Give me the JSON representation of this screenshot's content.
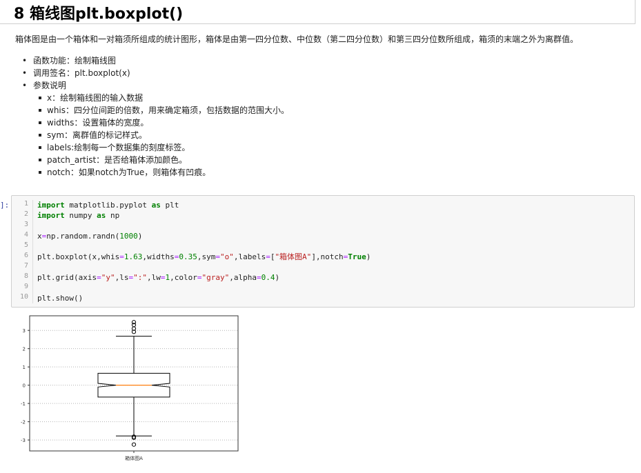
{
  "header": {
    "title": "8  箱线图plt.boxplot()"
  },
  "description": "箱体图是由一个箱体和一对箱须所组成的统计图形，箱体是由第一四分位数、中位数（第二四分位数）和第三四分位数所组成，箱须的末端之外为离群值。",
  "bullets": [
    "函数功能：绘制箱线图",
    "调用签名：plt.boxplot(x)",
    "参数说明"
  ],
  "params": [
    "x：绘制箱线图的输入数据",
    "whis：四分位间距的倍数，用来确定箱须，包括数据的范围大小。",
    "widths：设置箱体的宽度。",
    "sym：离群值的标记样式。",
    "labels:绘制每一个数据集的刻度标签。",
    "patch_artist：是否给箱体添加颜色。",
    "notch：如果notch为True，则箱体有凹痕。"
  ],
  "cell": {
    "prompt": "]:",
    "line_numbers": [
      "1",
      "2",
      "3",
      "4",
      "5",
      "6",
      "7",
      "8",
      "9",
      "10"
    ]
  },
  "code_lines": [
    "import matplotlib.pyplot as plt",
    "import numpy as np",
    "",
    "x=np.random.randn(1000)",
    "",
    "plt.boxplot(x,whis=1.63,widths=0.35,sym=\"o\",labels=[\"箱体图A\"],notch=True)",
    "",
    "plt.grid(axis=\"y\",ls=\":\",lw=1,color=\"gray\",alpha=0.4)",
    "",
    "plt.show()"
  ],
  "chart_data": {
    "type": "boxplot",
    "categories": [
      "箱体图A"
    ],
    "yticks": [
      -3,
      -2,
      -1,
      0,
      1,
      2,
      3
    ],
    "ylim": [
      -3.6,
      3.8
    ],
    "grid": "y",
    "box": {
      "q1": -0.65,
      "median": 0.0,
      "q3": 0.65,
      "notch_low": -0.1,
      "notch_high": 0.1,
      "whisker_low": -2.78,
      "whisker_high": 2.68,
      "outliers": [
        3.45,
        3.3,
        3.1,
        2.92,
        -2.82,
        -2.88,
        -3.25
      ]
    },
    "colors": {
      "median": "#ff7f0e",
      "box": "#000000",
      "grid": "#808080"
    }
  }
}
